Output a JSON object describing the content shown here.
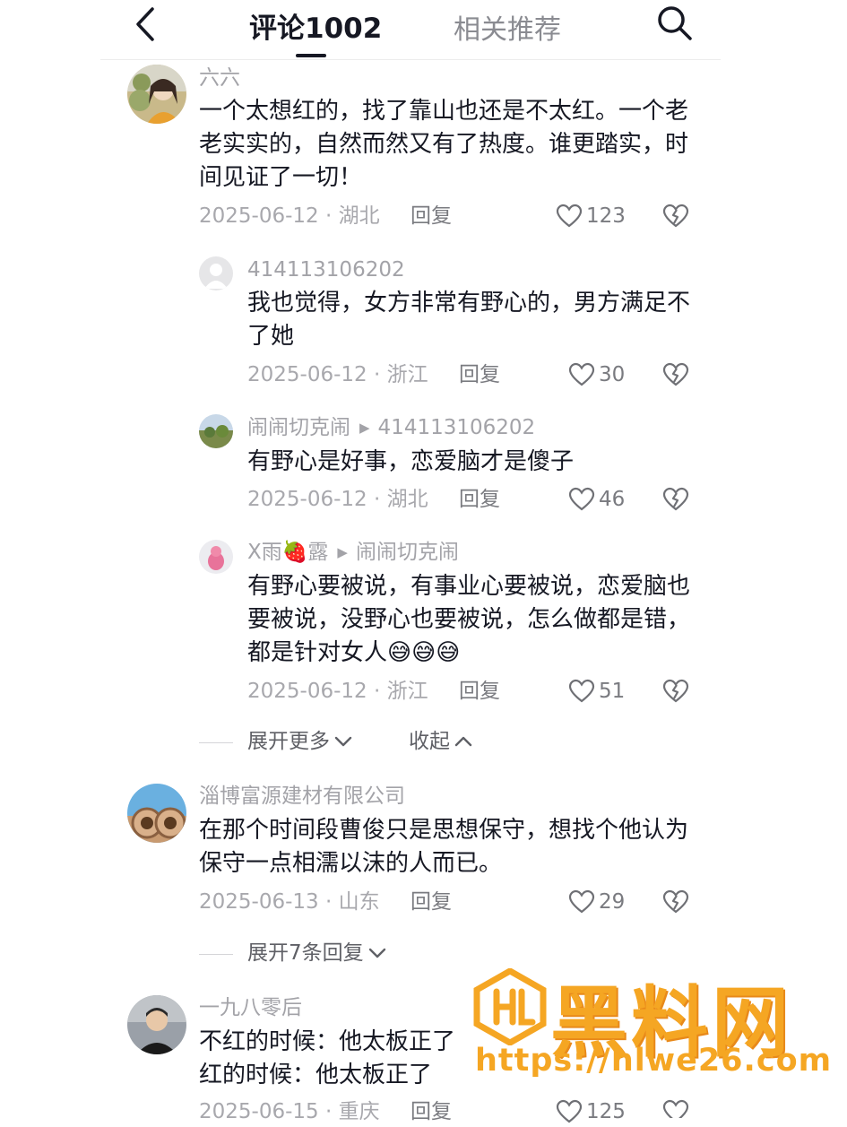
{
  "header": {
    "tab_comments": "评论1002",
    "tab_related": "相关推荐"
  },
  "comments": [
    {
      "user": "六六",
      "text": "一个太想红的，找了靠山也还是不太红。一个老老实实的，自然而然又有了热度。谁更踏实，时间见证了一切！",
      "date_loc": "2025-06-12 · 湖北",
      "reply_label": "回复",
      "likes": "123"
    },
    {
      "user": "414113106202",
      "text": "我也觉得，女方非常有野心的，男方满足不了她",
      "date_loc": "2025-06-12 · 浙江",
      "reply_label": "回复",
      "likes": "30"
    },
    {
      "user": "闹闹切克闹",
      "reply_to": "414113106202",
      "text": "有野心是好事，恋爱脑才是傻子",
      "date_loc": "2025-06-12 · 湖北",
      "reply_label": "回复",
      "likes": "46"
    },
    {
      "user": "X雨🍓露",
      "reply_to": "闹闹切克闹",
      "text": "有野心要被说，有事业心要被说，恋爱脑也要被说，没野心也要被说，怎么做都是错，都是针对女人😅😅😅",
      "date_loc": "2025-06-12 · 浙江",
      "reply_label": "回复",
      "likes": "51"
    },
    {
      "user": "淄博富源建材有限公司",
      "text": "在那个时间段曹俊只是思想保守，想找个他认为保守一点相濡以沫的人而已。",
      "date_loc": "2025-06-13 · 山东",
      "reply_label": "回复",
      "likes": "29"
    },
    {
      "user": "一九八零后",
      "text_lines": [
        "不红的时候：他太板正了",
        "红的时候：他太板正了"
      ],
      "date_loc": "2025-06-15 · 重庆",
      "reply_label": "回复",
      "likes": "125"
    }
  ],
  "expand_more": "展开更多",
  "collapse": "收起",
  "expand_replies": "展开7条回复",
  "watermark": {
    "title": "黑料网",
    "url": "https://hlwe26.com",
    "color": "#f5a623"
  },
  "icons": [
    "back-arrow-icon",
    "search-icon",
    "heart-icon",
    "dislike-heart-icon",
    "chevron-down-icon",
    "chevron-up-icon"
  ]
}
